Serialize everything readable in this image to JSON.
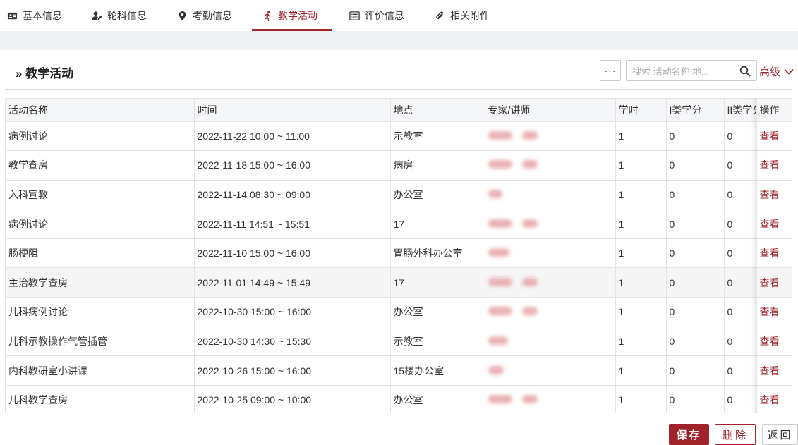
{
  "tabs": [
    {
      "label": "基本信息",
      "icon": "id-card-icon"
    },
    {
      "label": "轮科信息",
      "icon": "user-edit-icon"
    },
    {
      "label": "考勤信息",
      "icon": "map-pin-icon"
    },
    {
      "label": "教学活动",
      "icon": "running-icon",
      "active": true
    },
    {
      "label": "评价信息",
      "icon": "list-icon"
    },
    {
      "label": "相关附件",
      "icon": "paperclip-icon"
    }
  ],
  "section": {
    "title": "» 教学活动"
  },
  "toolbar": {
    "more_label": "···",
    "search_placeholder": "搜索 活动名称,地...",
    "advanced_label": "高级"
  },
  "table": {
    "headers": [
      "活动名称",
      "时间",
      "地点",
      "专家/讲师",
      "学时",
      "I类学分",
      "II类学分",
      "操作"
    ],
    "rows": [
      {
        "name": "病例讨论",
        "time": "2022-11-22 10:00 ~ 11:00",
        "place": "示教室",
        "hours": "1",
        "credit1": "0",
        "credit2": "0",
        "action": "查看"
      },
      {
        "name": "教学查房",
        "time": "2022-11-18 15:00 ~ 16:00",
        "place": "病房",
        "hours": "1",
        "credit1": "0",
        "credit2": "0",
        "action": "查看"
      },
      {
        "name": "入科宣教",
        "time": "2022-11-14 08:30 ~ 09:00",
        "place": "办公室",
        "hours": "1",
        "credit1": "0",
        "credit2": "0",
        "action": "查看"
      },
      {
        "name": "病例讨论",
        "time": "2022-11-11 14:51 ~ 15:51",
        "place": "17",
        "hours": "1",
        "credit1": "0",
        "credit2": "0",
        "action": "查看"
      },
      {
        "name": "肠梗阻",
        "time": "2022-11-10 15:00 ~ 16:00",
        "place": "胃肠外科办公室",
        "hours": "1",
        "credit1": "0",
        "credit2": "0",
        "action": "查看"
      },
      {
        "name": "主治教学查房",
        "time": "2022-11-01 14:49 ~ 15:49",
        "place": "17",
        "hours": "1",
        "credit1": "0",
        "credit2": "0",
        "action": "查看"
      },
      {
        "name": "儿科病例讨论",
        "time": "2022-10-30 15:00 ~ 16:00",
        "place": "办公室",
        "hours": "1",
        "credit1": "0",
        "credit2": "0",
        "action": "查看"
      },
      {
        "name": "儿科示教操作气管插管",
        "time": "2022-10-30 14:30 ~ 15:30",
        "place": "示教室",
        "hours": "1",
        "credit1": "0",
        "credit2": "0",
        "action": "查看"
      },
      {
        "name": "内科教研室小讲课",
        "time": "2022-10-26 15:00 ~ 16:00",
        "place": "15楼办公室",
        "hours": "1",
        "credit1": "0",
        "credit2": "0",
        "action": "查看"
      },
      {
        "name": "儿科教学查房",
        "time": "2022-10-25 09:00 ~ 10:00",
        "place": "办公室",
        "hours": "1",
        "credit1": "0",
        "credit2": "0",
        "action": "查看"
      }
    ]
  },
  "footer": {
    "save_label": "保存",
    "delete_label": "删除",
    "back_label": "返回"
  },
  "colors": {
    "accent": "#a0232a",
    "band": "#eef0f3"
  }
}
